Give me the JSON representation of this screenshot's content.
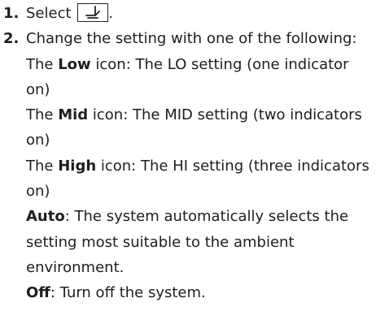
{
  "steps": [
    {
      "number": "1.",
      "text_before_icon": "Select ",
      "icon": "seat-heater-icon",
      "text_after_icon": "."
    },
    {
      "number": "2.",
      "intro": "Change the setting with one of the following:",
      "options": [
        {
          "prefix": "The ",
          "term": "Low",
          "rest": " icon: The LO setting (one indicator on)"
        },
        {
          "prefix": "The ",
          "term": "Mid",
          "rest": " icon: The MID setting (two indicators on)"
        },
        {
          "prefix": "The ",
          "term": "High",
          "rest": " icon: The HI setting (three indicators on)"
        },
        {
          "prefix": "",
          "term": "Auto",
          "rest": ": The system automatically selects the setting most suitable to the ambient environment."
        },
        {
          "prefix": "",
          "term": "Off",
          "rest": ": Turn off the system."
        }
      ]
    }
  ],
  "colors": {
    "text": "#1e1e1e",
    "background": "#ffffff"
  }
}
